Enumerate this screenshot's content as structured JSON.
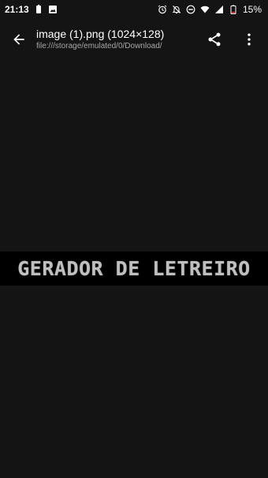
{
  "status_bar": {
    "time": "21:13",
    "battery_percent": "15%",
    "left_icons": [
      "battery-saver-icon",
      "image-notification-icon"
    ],
    "right_icons": [
      "alarm-icon",
      "notifications-off-icon",
      "do-not-disturb-icon",
      "wifi-icon",
      "signal-icon",
      "battery-low-icon"
    ]
  },
  "toolbar": {
    "title": "image (1).png (1024×128)",
    "subtitle": "file:///storage/emulated/0/Download/"
  },
  "image": {
    "text": "GERADOR DE LETREIRO"
  },
  "colors": {
    "background": "#141414",
    "image_strip": "#000000",
    "image_text": "#bfbfbf",
    "subtitle": "#a8a8a8",
    "battery_low": "#e53935"
  }
}
